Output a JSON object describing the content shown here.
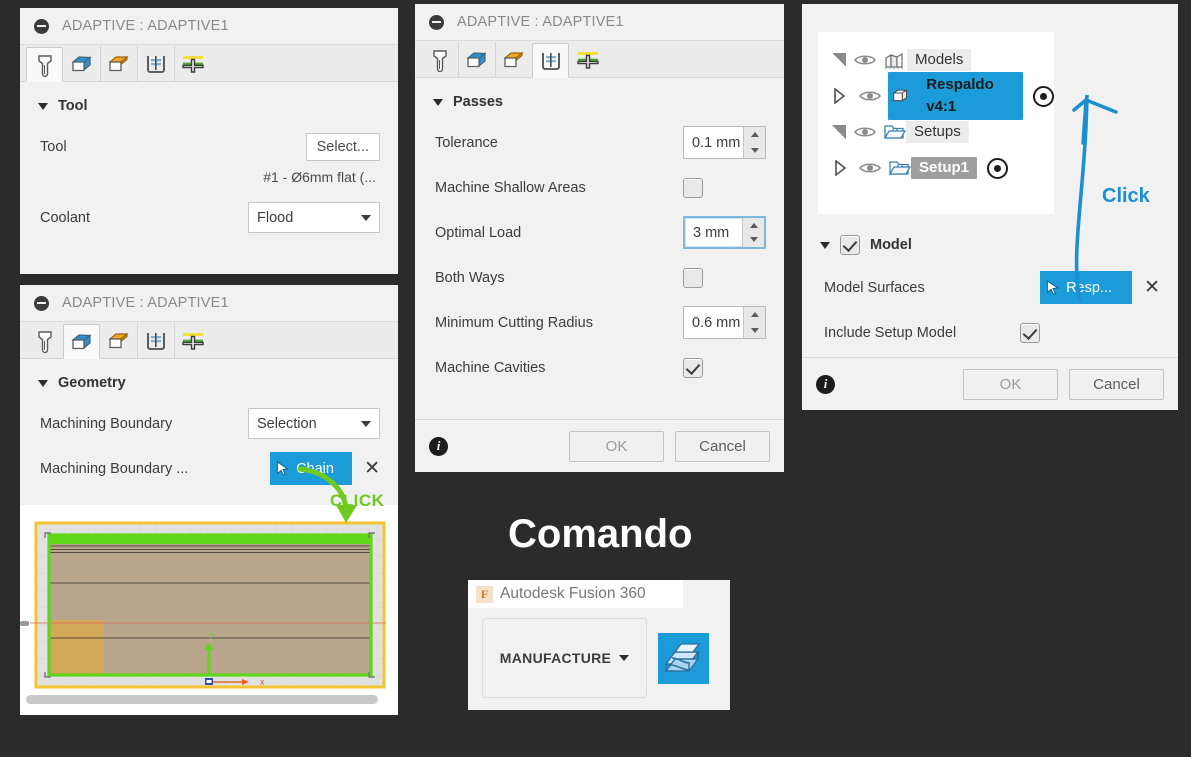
{
  "background_color": "#2b2b2b",
  "accent_blue": "#1b9cd8",
  "accent_green": "#6fc91f",
  "panels": {
    "tool_dialog": {
      "title": "ADAPTIVE : ADAPTIVE1",
      "tabs": [
        "tool-tab-icon",
        "geometry-tab-icon",
        "heights-tab-icon",
        "passes-tab-icon",
        "linking-tab-icon"
      ],
      "active_tab_index": 0,
      "section_label": "Tool",
      "rows": [
        {
          "label": "Tool",
          "value": "Select..."
        },
        {
          "label": "",
          "value": "#1 - Ø6mm flat (..."
        },
        {
          "label": "Coolant",
          "value": "Flood"
        }
      ]
    },
    "geometry_dialog": {
      "title": "ADAPTIVE : ADAPTIVE1",
      "active_tab_index": 1,
      "section_label": "Geometry",
      "rows": [
        {
          "label": "Machining Boundary",
          "value": "Selection"
        },
        {
          "label": "Machining Boundary ...",
          "value": "Chain"
        }
      ],
      "annotation": "CLICK"
    },
    "passes_dialog": {
      "title": "ADAPTIVE : ADAPTIVE1",
      "active_tab_index": 3,
      "section_label": "Passes",
      "rows": [
        {
          "label": "Tolerance",
          "value": "0.1 mm",
          "type": "spinner",
          "focused": false
        },
        {
          "label": "Machine Shallow Areas",
          "value": "",
          "type": "checkbox",
          "checked": false
        },
        {
          "label": "Optimal Load",
          "value": "3 mm",
          "type": "spinner",
          "focused": true
        },
        {
          "label": "Both Ways",
          "value": "",
          "type": "checkbox",
          "checked": false
        },
        {
          "label": "Minimum Cutting Radius",
          "value": "0.6 mm",
          "type": "spinner",
          "focused": false
        },
        {
          "label": "Machine Cavities",
          "value": "",
          "type": "checkbox",
          "checked": true
        }
      ],
      "footer": {
        "ok": "OK",
        "cancel": "Cancel"
      }
    },
    "model_dialog": {
      "tree": [
        {
          "label": "Models",
          "expander": "expanded",
          "icon": "models-icon",
          "style": "grey",
          "radio": false
        },
        {
          "label": "Respaldo v4:1",
          "expander": "collapsed",
          "icon": "body-icon",
          "style": "blue",
          "radio": true
        },
        {
          "label": "Setups",
          "expander": "expanded",
          "icon": "folder-icon",
          "style": "grey",
          "radio": false
        },
        {
          "label": "Setup1",
          "expander": "collapsed",
          "icon": "folder-icon",
          "style": "dark",
          "radio": true
        }
      ],
      "section_label": "Model",
      "section_checked": true,
      "rows": [
        {
          "label": "Model Surfaces",
          "value": "Resp...",
          "type": "selection"
        },
        {
          "label": "Include Setup Model",
          "value": "",
          "type": "checkbox",
          "checked": true
        }
      ],
      "footer": {
        "ok": "OK",
        "cancel": "Cancel"
      },
      "annotation": "Click"
    }
  },
  "comando": {
    "heading": "Comando",
    "app_name": "Autodesk Fusion 360",
    "app_badge": "F",
    "workspace_button": "MANUFACTURE",
    "manufacture_icon": "manufacture-workspace-icon"
  }
}
